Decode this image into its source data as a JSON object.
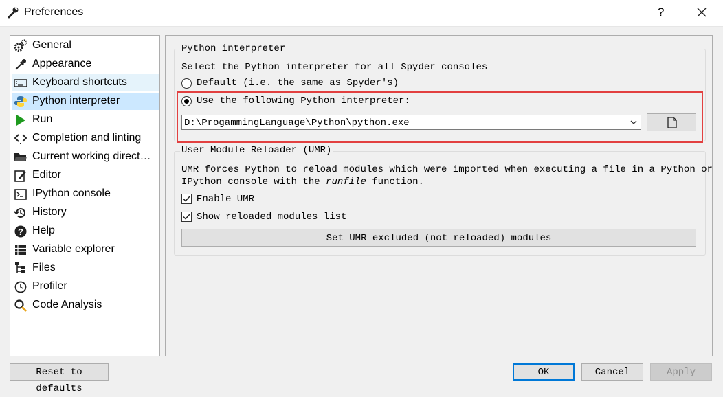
{
  "window": {
    "title": "Preferences",
    "help_glyph": "?",
    "wrench_icon": "wrench-icon",
    "close_icon": "close-icon"
  },
  "sidebar": {
    "items": [
      {
        "label": "General",
        "icon": "gears-icon"
      },
      {
        "label": "Appearance",
        "icon": "eyedropper-icon"
      },
      {
        "label": "Keyboard shortcuts",
        "icon": "keyboard-icon"
      },
      {
        "label": "Python interpreter",
        "icon": "python-icon",
        "selected": true
      },
      {
        "label": "Run",
        "icon": "play-icon"
      },
      {
        "label": "Completion and linting",
        "icon": "code-icon"
      },
      {
        "label": "Current working direct…",
        "icon": "folder-icon"
      },
      {
        "label": "Editor",
        "icon": "pencil-icon"
      },
      {
        "label": "IPython console",
        "icon": "terminal-icon"
      },
      {
        "label": "History",
        "icon": "history-icon"
      },
      {
        "label": "Help",
        "icon": "question-icon"
      },
      {
        "label": "Variable explorer",
        "icon": "table-icon"
      },
      {
        "label": "Files",
        "icon": "file-tree-icon"
      },
      {
        "label": "Profiler",
        "icon": "clock-icon"
      },
      {
        "label": "Code Analysis",
        "icon": "analysis-icon"
      }
    ]
  },
  "interpreter": {
    "group_title": "Python interpreter",
    "description": "Select the Python interpreter for all Spyder consoles",
    "default_option": "Default (i.e. the same as Spyder's)",
    "custom_option": "Use the following Python interpreter:",
    "selected_option": "custom",
    "path": "D:\\ProgammingLanguage\\Python\\python.exe",
    "browse_icon": "file-icon"
  },
  "umr": {
    "group_title": "User Module Reloader (UMR)",
    "desc_line1": "UMR forces Python to reload modules which were imported when executing a file in a Python or",
    "desc_line2_prefix": "IPython console with the ",
    "desc_line2_italic": "runfile",
    "desc_line2_suffix": " function.",
    "enable_label": "Enable UMR",
    "enable_checked": true,
    "show_list_label": "Show reloaded modules list",
    "show_list_checked": true,
    "excluded_button": "Set UMR excluded (not reloaded) modules"
  },
  "footer": {
    "reset": "Reset to defaults",
    "ok": "OK",
    "cancel": "Cancel",
    "apply": "Apply"
  },
  "colors": {
    "selected": "#cce8ff",
    "hover": "#e5f3fb",
    "highlight_box": "#e24040",
    "ok_border": "#0078d7"
  }
}
